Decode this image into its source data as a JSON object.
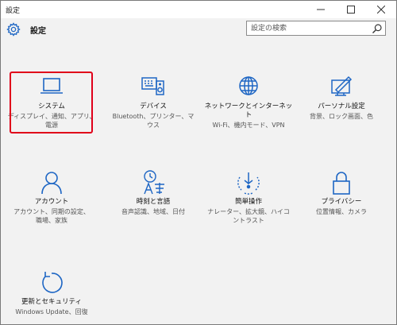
{
  "window": {
    "title": "設定"
  },
  "header": {
    "title": "設定"
  },
  "search": {
    "placeholder": "設定の検索"
  },
  "colors": {
    "accent": "#1e66c4",
    "highlight": "#e0001a",
    "background": "#f2f2f2"
  },
  "tiles": [
    {
      "label": "システム",
      "desc1": "ディスプレイ、通知、アプリ、",
      "desc2": "電源",
      "icon": "laptop-icon",
      "selected": true
    },
    {
      "label": "デバイス",
      "desc1": "Bluetooth、プリンター、マ",
      "desc2": "ウス",
      "icon": "devices-icon"
    },
    {
      "label": "ネットワークとインターネット",
      "desc1": "Wi-Fi、機内モード、VPN",
      "desc2": "",
      "icon": "globe-icon"
    },
    {
      "label": "パーソナル設定",
      "desc1": "背景、ロック画面、色",
      "desc2": "",
      "icon": "personalization-icon"
    },
    {
      "label": "アカウント",
      "desc1": "アカウント、同期の設定、",
      "desc2": "職場、家族",
      "icon": "person-icon"
    },
    {
      "label": "時刻と言語",
      "desc1": "音声認識、地域、日付",
      "desc2": "",
      "icon": "time-language-icon"
    },
    {
      "label": "簡単操作",
      "desc1": "ナレーター、拡大鏡、ハイコ",
      "desc2": "ントラスト",
      "icon": "ease-of-access-icon"
    },
    {
      "label": "プライバシー",
      "desc1": "位置情報、カメラ",
      "desc2": "",
      "icon": "lock-icon"
    },
    {
      "label": "更新とセキュリティ",
      "desc1": "Windows Update、回復",
      "desc2": "",
      "icon": "update-icon"
    }
  ]
}
